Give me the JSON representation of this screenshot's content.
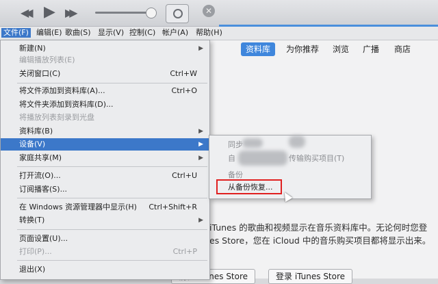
{
  "toolbar": {
    "prev_icon": "◀◀",
    "play_icon": "▶",
    "next_icon": "▶▶",
    "close_glyph": "✕"
  },
  "menubar": {
    "items": [
      "文件(F)",
      "编辑(E)",
      "歌曲(S)",
      "显示(V)",
      "控制(C)",
      "帐户(A)",
      "帮助(H)"
    ]
  },
  "nav": {
    "tabs": [
      "资料库",
      "为你推荐",
      "浏览",
      "广播",
      "商店"
    ]
  },
  "main": {
    "line1": "iTunes 的歌曲和视频显示在音乐资料库中。无论何时您登",
    "line2": "es Store，您在 iCloud 中的音乐购买项目都将显示出来。",
    "btn_store": "前往 iTunes Store",
    "btn_login": "登录 iTunes Store"
  },
  "file_menu": {
    "items": [
      {
        "label": "新建(N)",
        "shortcut": "",
        "submenu": true,
        "disabled": false
      },
      {
        "label": "编辑播放列表(E)",
        "shortcut": "",
        "submenu": false,
        "disabled": true
      },
      {
        "label": "关闭窗口(C)",
        "shortcut": "Ctrl+W",
        "submenu": false,
        "disabled": false
      },
      {
        "label": "将文件添加到资料库(A)...",
        "shortcut": "Ctrl+O",
        "submenu": false,
        "disabled": false
      },
      {
        "label": "将文件夹添加到资料库(D)...",
        "shortcut": "",
        "submenu": false,
        "disabled": false
      },
      {
        "label": "将播放列表刻录到光盘",
        "shortcut": "",
        "submenu": false,
        "disabled": true
      },
      {
        "label": "资料库(B)",
        "shortcut": "",
        "submenu": true,
        "disabled": false
      },
      {
        "label": "设备(V)",
        "shortcut": "",
        "submenu": true,
        "disabled": false,
        "highlighted": true
      },
      {
        "label": "家庭共享(M)",
        "shortcut": "",
        "submenu": true,
        "disabled": false
      },
      {
        "label": "打开流(O)...",
        "shortcut": "Ctrl+U",
        "submenu": false,
        "disabled": false
      },
      {
        "label": "订阅播客(S)...",
        "shortcut": "",
        "submenu": false,
        "disabled": false
      },
      {
        "label": "在 Windows 资源管理器中显示(H)",
        "shortcut": "Ctrl+Shift+R",
        "submenu": false,
        "disabled": false
      },
      {
        "label": "转换(T)",
        "shortcut": "",
        "submenu": true,
        "disabled": false
      },
      {
        "label": "页面设置(U)...",
        "shortcut": "",
        "submenu": false,
        "disabled": false
      },
      {
        "label": "打印(P)...",
        "shortcut": "Ctrl+P",
        "submenu": false,
        "disabled": true
      },
      {
        "label": "退出(X)",
        "shortcut": "",
        "submenu": false,
        "disabled": false
      }
    ]
  },
  "device_submenu": {
    "sync": "同步",
    "transfer": "自",
    "transfer_suffix": "传输购买项目(T)",
    "backup": "备份",
    "restore": "从备份恢复..."
  },
  "colors": {
    "accent": "#3c78c9",
    "highlight_box": "#e02020"
  }
}
